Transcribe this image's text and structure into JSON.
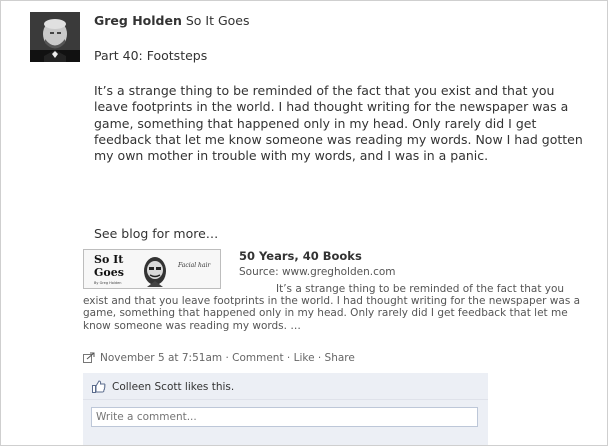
{
  "post": {
    "author": "Greg Holden",
    "app": "So It Goes",
    "part_title": "Part 40: Footsteps",
    "body": "It’s a strange thing to be reminded of the fact that you exist and that you leave footprints in the world. I had thought writing for the newspaper was a game, something that happened only in my head. Only rarely did I get feedback that let me know someone was reading my words. Now I had gotten my own mother in trouble with my words, and I was in a panic.",
    "see_more": "See blog for more…"
  },
  "attachment": {
    "title": "50 Years, 40 Books",
    "source": "Source: www.gregholden.com",
    "description": "It’s a strange thing to be reminded of the fact that you exist and that you leave footprints in the world. I had thought writing for the newspaper was a game, something that happened only in my head. Only rarely did I get feedback that let me know someone was reading my words. …",
    "thumb_title_line1": "So It",
    "thumb_title_line2": "Goes",
    "thumb_byline": "By Greg Holden",
    "thumb_caption": "Facial hair"
  },
  "meta": {
    "timestamp": "November 5 at 7:51am",
    "sep": " · ",
    "comment": "Comment",
    "like": "Like",
    "share": "Share"
  },
  "likes": {
    "text": "Colleen Scott likes this."
  },
  "comment_box": {
    "placeholder": "Write a comment..."
  }
}
